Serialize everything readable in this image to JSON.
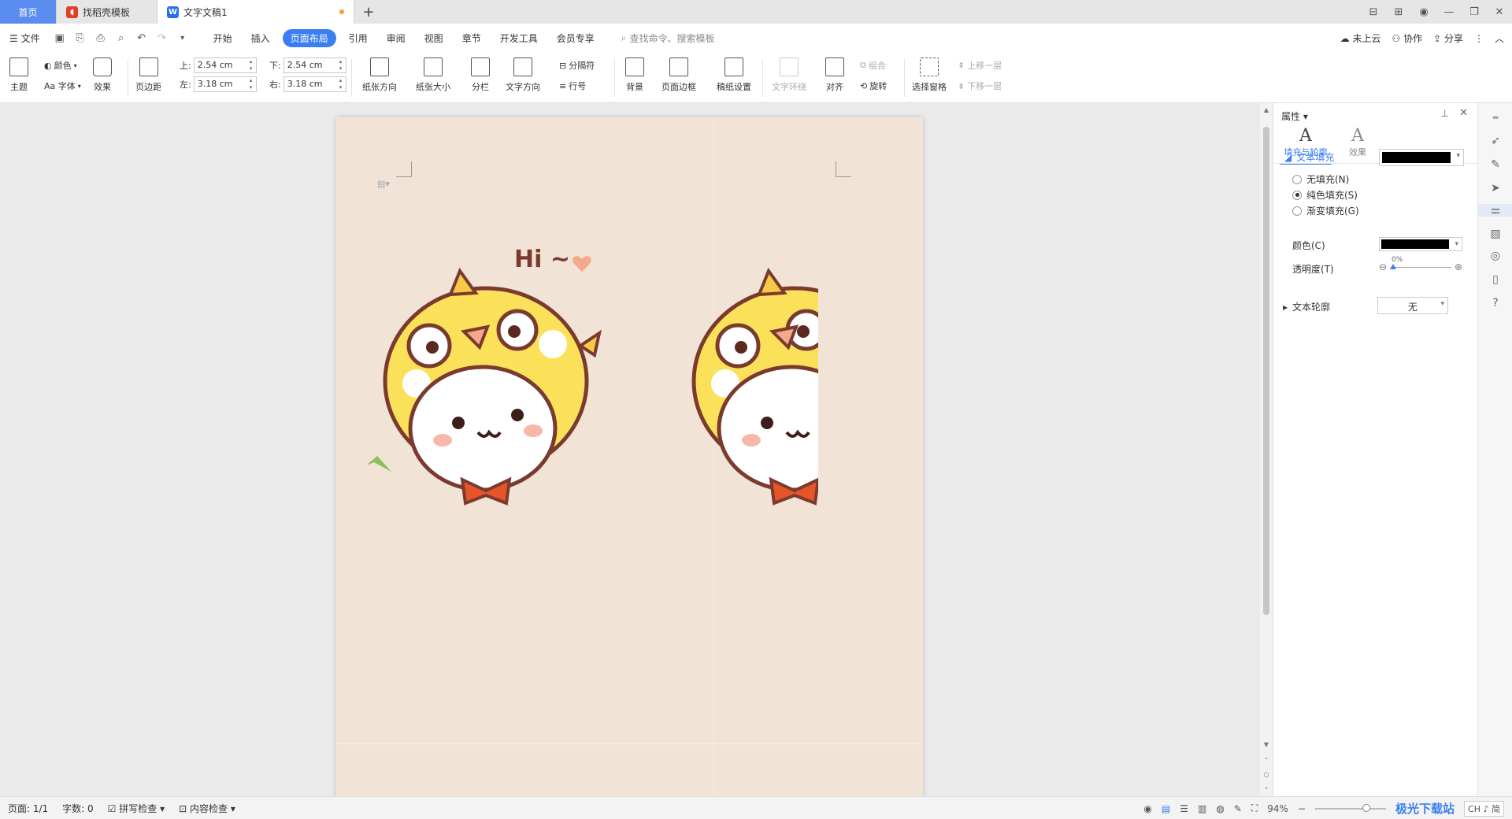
{
  "tabs": {
    "home": "首页",
    "template": "找稻壳模板",
    "document": "文字文稿1"
  },
  "menu": {
    "file": "文件",
    "items": [
      "开始",
      "插入",
      "页面布局",
      "引用",
      "审阅",
      "视图",
      "章节",
      "开发工具",
      "会员专享"
    ],
    "active_index": 2,
    "search_placeholder": "查找命令、搜索模板",
    "cloud": "未上云",
    "collab": "协作",
    "share": "分享"
  },
  "ribbon": {
    "theme": "主题",
    "color": "颜色",
    "font": "Aa 字体",
    "effect": "效果",
    "margins": "页边距",
    "top_label": "上:",
    "top_value": "2.54 cm",
    "bottom_label": "下:",
    "bottom_value": "2.54 cm",
    "left_label": "左:",
    "left_value": "3.18 cm",
    "right_label": "右:",
    "right_value": "3.18 cm",
    "orientation": "纸张方向",
    "size": "纸张大小",
    "columns": "分栏",
    "text_direction": "文字方向",
    "breaks": "分隔符",
    "line_numbers": "行号",
    "background": "背景",
    "page_border": "页面边框",
    "manuscript": "稿纸设置",
    "text_wrap": "文字环绕",
    "align": "对齐",
    "group": "组合",
    "rotate": "旋转",
    "selection_pane": "选择窗格",
    "bring_forward": "上移一层",
    "send_backward": "下移一层"
  },
  "document": {
    "sticker_text": "Hi ~"
  },
  "panel": {
    "title": "属性",
    "tab_fill": "填充与轮廓",
    "tab_effect": "效果",
    "text_fill": "文本填充",
    "no_fill": "无填充(N)",
    "solid_fill": "纯色填充(S)",
    "gradient_fill": "渐变填充(G)",
    "color_label": "颜色(C)",
    "transparency_label": "透明度(T)",
    "transparency_value": "0%",
    "text_outline": "文本轮廓",
    "outline_value": "无",
    "fill_color": "#000000"
  },
  "status": {
    "page": "页面: 1/1",
    "words": "字数: 0",
    "spell": "拼写检查",
    "content": "内容检查",
    "zoom": "94%",
    "ime": "CH ♪ 简",
    "watermark": "极光下载站"
  }
}
